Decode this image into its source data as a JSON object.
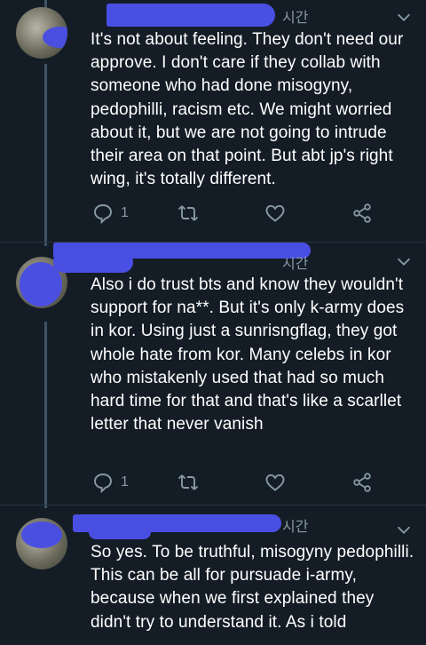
{
  "tweets": [
    {
      "time_suffix": "시간",
      "text": "It's not about feeling. They don't need our approve. I don't care if they collab with someone who had done misogyny, pedophilli, racism etc. We might worried about it, but we are not going to intrude their area on that point. But abt jp's right wing, it's totally different.",
      "reply_count": "1"
    },
    {
      "time_suffix": "시간",
      "text": "Also i do trust bts and know they wouldn't support for na**. But it's only k-army does in kor. Using just a sunrisngflag, they got whole hate from kor. Many celebs in kor who mistakenly used that had so much hard time for that and that's like a scarllet letter that never vanish",
      "reply_count": "1"
    },
    {
      "time_suffix": "시간",
      "text": "So yes. To be truthful, misogyny pedophilli. This can be all for pursuade i-army, because when we first explained they didn't try to understand it. As i told"
    }
  ],
  "colors": {
    "background": "#141d26",
    "secondary_text": "#8899a6",
    "redaction": "#4a4fe3",
    "thread_line": "#3d5466"
  },
  "icons": [
    "reply-icon",
    "retweet-icon",
    "like-icon",
    "share-icon",
    "chevron-down-icon"
  ]
}
